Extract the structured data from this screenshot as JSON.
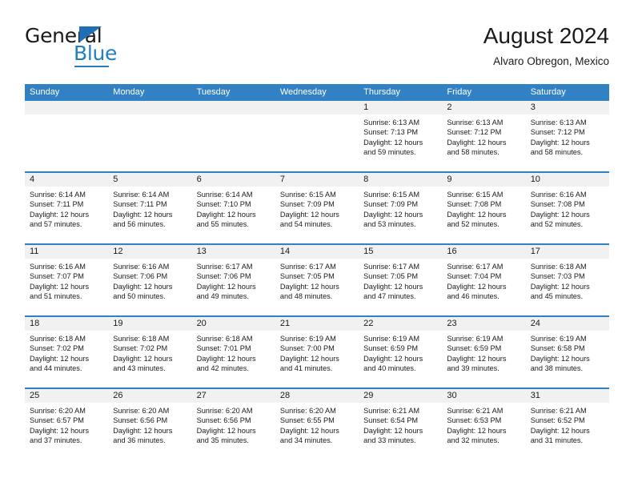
{
  "brand": {
    "name_top": "General",
    "name_bottom": "Blue",
    "triangle_icon": "triangle-icon",
    "accent_color": "#1f7ec4"
  },
  "header": {
    "title": "August 2024",
    "subtitle": "Alvaro Obregon, Mexico"
  },
  "theme": {
    "header_bg": "#3281c4",
    "daynum_bg": "#f1f1f1",
    "text": "#1a1a1a"
  },
  "calendar": {
    "weekday_headers": [
      "Sunday",
      "Monday",
      "Tuesday",
      "Wednesday",
      "Thursday",
      "Friday",
      "Saturday"
    ],
    "weeks": [
      [
        {
          "day": "",
          "empty": true,
          "lines": []
        },
        {
          "day": "",
          "empty": true,
          "lines": []
        },
        {
          "day": "",
          "empty": true,
          "lines": []
        },
        {
          "day": "",
          "empty": true,
          "lines": []
        },
        {
          "day": "1",
          "empty": false,
          "lines": [
            "Sunrise: 6:13 AM",
            "Sunset: 7:13 PM",
            "Daylight: 12 hours",
            "and 59 minutes."
          ]
        },
        {
          "day": "2",
          "empty": false,
          "lines": [
            "Sunrise: 6:13 AM",
            "Sunset: 7:12 PM",
            "Daylight: 12 hours",
            "and 58 minutes."
          ]
        },
        {
          "day": "3",
          "empty": false,
          "lines": [
            "Sunrise: 6:13 AM",
            "Sunset: 7:12 PM",
            "Daylight: 12 hours",
            "and 58 minutes."
          ]
        }
      ],
      [
        {
          "day": "4",
          "empty": false,
          "lines": [
            "Sunrise: 6:14 AM",
            "Sunset: 7:11 PM",
            "Daylight: 12 hours",
            "and 57 minutes."
          ]
        },
        {
          "day": "5",
          "empty": false,
          "lines": [
            "Sunrise: 6:14 AM",
            "Sunset: 7:11 PM",
            "Daylight: 12 hours",
            "and 56 minutes."
          ]
        },
        {
          "day": "6",
          "empty": false,
          "lines": [
            "Sunrise: 6:14 AM",
            "Sunset: 7:10 PM",
            "Daylight: 12 hours",
            "and 55 minutes."
          ]
        },
        {
          "day": "7",
          "empty": false,
          "lines": [
            "Sunrise: 6:15 AM",
            "Sunset: 7:09 PM",
            "Daylight: 12 hours",
            "and 54 minutes."
          ]
        },
        {
          "day": "8",
          "empty": false,
          "lines": [
            "Sunrise: 6:15 AM",
            "Sunset: 7:09 PM",
            "Daylight: 12 hours",
            "and 53 minutes."
          ]
        },
        {
          "day": "9",
          "empty": false,
          "lines": [
            "Sunrise: 6:15 AM",
            "Sunset: 7:08 PM",
            "Daylight: 12 hours",
            "and 52 minutes."
          ]
        },
        {
          "day": "10",
          "empty": false,
          "lines": [
            "Sunrise: 6:16 AM",
            "Sunset: 7:08 PM",
            "Daylight: 12 hours",
            "and 52 minutes."
          ]
        }
      ],
      [
        {
          "day": "11",
          "empty": false,
          "lines": [
            "Sunrise: 6:16 AM",
            "Sunset: 7:07 PM",
            "Daylight: 12 hours",
            "and 51 minutes."
          ]
        },
        {
          "day": "12",
          "empty": false,
          "lines": [
            "Sunrise: 6:16 AM",
            "Sunset: 7:06 PM",
            "Daylight: 12 hours",
            "and 50 minutes."
          ]
        },
        {
          "day": "13",
          "empty": false,
          "lines": [
            "Sunrise: 6:17 AM",
            "Sunset: 7:06 PM",
            "Daylight: 12 hours",
            "and 49 minutes."
          ]
        },
        {
          "day": "14",
          "empty": false,
          "lines": [
            "Sunrise: 6:17 AM",
            "Sunset: 7:05 PM",
            "Daylight: 12 hours",
            "and 48 minutes."
          ]
        },
        {
          "day": "15",
          "empty": false,
          "lines": [
            "Sunrise: 6:17 AM",
            "Sunset: 7:05 PM",
            "Daylight: 12 hours",
            "and 47 minutes."
          ]
        },
        {
          "day": "16",
          "empty": false,
          "lines": [
            "Sunrise: 6:17 AM",
            "Sunset: 7:04 PM",
            "Daylight: 12 hours",
            "and 46 minutes."
          ]
        },
        {
          "day": "17",
          "empty": false,
          "lines": [
            "Sunrise: 6:18 AM",
            "Sunset: 7:03 PM",
            "Daylight: 12 hours",
            "and 45 minutes."
          ]
        }
      ],
      [
        {
          "day": "18",
          "empty": false,
          "lines": [
            "Sunrise: 6:18 AM",
            "Sunset: 7:02 PM",
            "Daylight: 12 hours",
            "and 44 minutes."
          ]
        },
        {
          "day": "19",
          "empty": false,
          "lines": [
            "Sunrise: 6:18 AM",
            "Sunset: 7:02 PM",
            "Daylight: 12 hours",
            "and 43 minutes."
          ]
        },
        {
          "day": "20",
          "empty": false,
          "lines": [
            "Sunrise: 6:18 AM",
            "Sunset: 7:01 PM",
            "Daylight: 12 hours",
            "and 42 minutes."
          ]
        },
        {
          "day": "21",
          "empty": false,
          "lines": [
            "Sunrise: 6:19 AM",
            "Sunset: 7:00 PM",
            "Daylight: 12 hours",
            "and 41 minutes."
          ]
        },
        {
          "day": "22",
          "empty": false,
          "lines": [
            "Sunrise: 6:19 AM",
            "Sunset: 6:59 PM",
            "Daylight: 12 hours",
            "and 40 minutes."
          ]
        },
        {
          "day": "23",
          "empty": false,
          "lines": [
            "Sunrise: 6:19 AM",
            "Sunset: 6:59 PM",
            "Daylight: 12 hours",
            "and 39 minutes."
          ]
        },
        {
          "day": "24",
          "empty": false,
          "lines": [
            "Sunrise: 6:19 AM",
            "Sunset: 6:58 PM",
            "Daylight: 12 hours",
            "and 38 minutes."
          ]
        }
      ],
      [
        {
          "day": "25",
          "empty": false,
          "lines": [
            "Sunrise: 6:20 AM",
            "Sunset: 6:57 PM",
            "Daylight: 12 hours",
            "and 37 minutes."
          ]
        },
        {
          "day": "26",
          "empty": false,
          "lines": [
            "Sunrise: 6:20 AM",
            "Sunset: 6:56 PM",
            "Daylight: 12 hours",
            "and 36 minutes."
          ]
        },
        {
          "day": "27",
          "empty": false,
          "lines": [
            "Sunrise: 6:20 AM",
            "Sunset: 6:56 PM",
            "Daylight: 12 hours",
            "and 35 minutes."
          ]
        },
        {
          "day": "28",
          "empty": false,
          "lines": [
            "Sunrise: 6:20 AM",
            "Sunset: 6:55 PM",
            "Daylight: 12 hours",
            "and 34 minutes."
          ]
        },
        {
          "day": "29",
          "empty": false,
          "lines": [
            "Sunrise: 6:21 AM",
            "Sunset: 6:54 PM",
            "Daylight: 12 hours",
            "and 33 minutes."
          ]
        },
        {
          "day": "30",
          "empty": false,
          "lines": [
            "Sunrise: 6:21 AM",
            "Sunset: 6:53 PM",
            "Daylight: 12 hours",
            "and 32 minutes."
          ]
        },
        {
          "day": "31",
          "empty": false,
          "lines": [
            "Sunrise: 6:21 AM",
            "Sunset: 6:52 PM",
            "Daylight: 12 hours",
            "and 31 minutes."
          ]
        }
      ]
    ]
  }
}
